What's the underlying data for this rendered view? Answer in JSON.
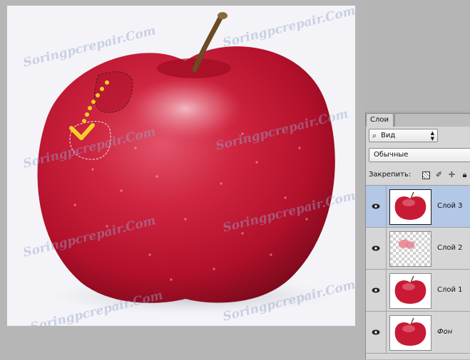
{
  "watermark_text": "Soringpcrepair.Com",
  "layers_panel": {
    "tab_label": "Слои",
    "filter": {
      "label": "Вид",
      "icon": "search-icon"
    },
    "blend_mode": "Обычные",
    "lock_label": "Закрепить:",
    "lock_icons": [
      "lock-transparent-icon",
      "brush-icon",
      "move-icon",
      "lock-icon"
    ],
    "layers": [
      {
        "name": "Слой 3",
        "selected": true,
        "visible": true,
        "thumbnail": "apple-thumbnail-icon"
      },
      {
        "name": "Слой 2",
        "selected": false,
        "visible": true,
        "thumbnail": "transparent-patch-thumbnail-icon"
      },
      {
        "name": "Слой 1",
        "selected": false,
        "visible": true,
        "thumbnail": "apple-thumbnail-icon"
      },
      {
        "name": "Фон",
        "selected": false,
        "visible": true,
        "thumbnail": "apple-thumbnail-icon",
        "italic": true
      }
    ]
  },
  "colors": {
    "selection_highlight": "#b3c7e6",
    "arrow": "#f5cf2a",
    "apple_red": "#c8102e"
  }
}
